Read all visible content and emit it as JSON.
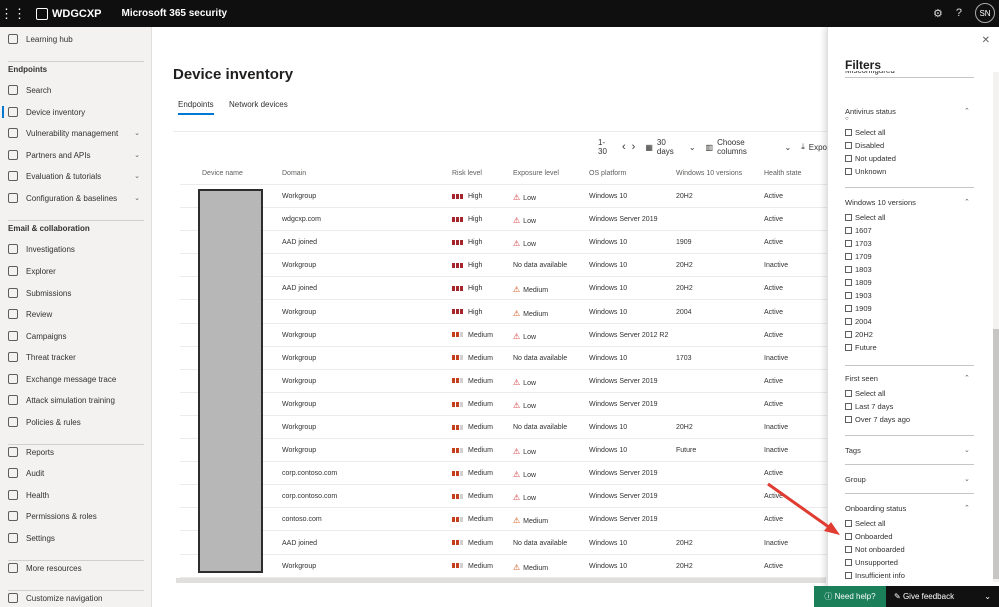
{
  "topbar": {
    "brand": "WDGCXP",
    "app": "Microsoft 365 security",
    "avatar": "SN",
    "icons": [
      "waffle-icon",
      "gear-icon",
      "help-icon"
    ]
  },
  "sidebar": {
    "items": [
      {
        "label": "Learning hub",
        "icon": "learning-hub-icon"
      },
      {
        "label": "Endpoints",
        "section": true
      },
      {
        "label": "Search",
        "icon": "search-icon"
      },
      {
        "label": "Device inventory",
        "icon": "device-inventory-icon",
        "active": true
      },
      {
        "label": "Vulnerability management",
        "icon": "vulnerability-icon",
        "chevron": true
      },
      {
        "label": "Partners and APIs",
        "icon": "partners-icon",
        "chevron": true
      },
      {
        "label": "Evaluation & tutorials",
        "icon": "evaluation-icon",
        "chevron": true
      },
      {
        "label": "Configuration & baselines",
        "icon": "configuration-icon",
        "chevron": true
      },
      {
        "label": "Email & collaboration",
        "section": true
      },
      {
        "label": "Investigations",
        "icon": "investigations-icon"
      },
      {
        "label": "Explorer",
        "icon": "explorer-icon"
      },
      {
        "label": "Submissions",
        "icon": "submissions-icon"
      },
      {
        "label": "Review",
        "icon": "review-icon"
      },
      {
        "label": "Campaigns",
        "icon": "campaigns-icon"
      },
      {
        "label": "Threat tracker",
        "icon": "threat-tracker-icon"
      },
      {
        "label": "Exchange message trace",
        "icon": "exchange-icon"
      },
      {
        "label": "Attack simulation training",
        "icon": "attack-sim-icon"
      },
      {
        "label": "Policies & rules",
        "icon": "policies-icon"
      },
      {
        "label": "Reports",
        "icon": "reports-icon"
      },
      {
        "label": "Audit",
        "icon": "audit-icon"
      },
      {
        "label": "Health",
        "icon": "health-icon"
      },
      {
        "label": "Permissions & roles",
        "icon": "permissions-icon"
      },
      {
        "label": "Settings",
        "icon": "settings-icon"
      },
      {
        "label": "More resources",
        "icon": "more-resources-icon"
      },
      {
        "label": "Customize navigation",
        "icon": "customize-icon"
      }
    ]
  },
  "main": {
    "title": "Device inventory",
    "tabs": [
      "Endpoints",
      "Network devices"
    ],
    "toolbar": {
      "range": "1-30",
      "days": "30 days",
      "choose_columns": "Choose columns",
      "export": "Expo"
    },
    "columns": [
      "Device name",
      "Domain",
      "Risk level",
      "Exposure level",
      "OS platform",
      "Windows 10 versions",
      "Health state"
    ],
    "rows": [
      {
        "domain": "Workgroup",
        "risk": "High",
        "exposure": "Low",
        "os": "Windows 10",
        "ver": "20H2",
        "health": "Active"
      },
      {
        "domain": "wdgcxp.com",
        "risk": "High",
        "exposure": "Low",
        "os": "Windows Server 2019",
        "ver": "",
        "health": "Active"
      },
      {
        "domain": "AAD joined",
        "risk": "High",
        "exposure": "Low",
        "os": "Windows 10",
        "ver": "1909",
        "health": "Active"
      },
      {
        "domain": "Workgroup",
        "risk": "High",
        "exposure": "No data available",
        "os": "Windows 10",
        "ver": "20H2",
        "health": "Inactive"
      },
      {
        "domain": "AAD joined",
        "risk": "High",
        "exposure": "Medium",
        "os": "Windows 10",
        "ver": "20H2",
        "health": "Active"
      },
      {
        "domain": "Workgroup",
        "risk": "High",
        "exposure": "Medium",
        "os": "Windows 10",
        "ver": "2004",
        "health": "Active"
      },
      {
        "domain": "Workgroup",
        "risk": "Medium",
        "exposure": "Low",
        "os": "Windows Server 2012 R2",
        "ver": "",
        "health": "Active"
      },
      {
        "domain": "Workgroup",
        "risk": "Medium",
        "exposure": "No data available",
        "os": "Windows 10",
        "ver": "1703",
        "health": "Inactive"
      },
      {
        "domain": "Workgroup",
        "risk": "Medium",
        "exposure": "Low",
        "os": "Windows Server 2019",
        "ver": "",
        "health": "Active"
      },
      {
        "domain": "Workgroup",
        "risk": "Medium",
        "exposure": "Low",
        "os": "Windows Server 2019",
        "ver": "",
        "health": "Active"
      },
      {
        "domain": "Workgroup",
        "risk": "Medium",
        "exposure": "No data available",
        "os": "Windows 10",
        "ver": "20H2",
        "health": "Inactive"
      },
      {
        "domain": "Workgroup",
        "risk": "Medium",
        "exposure": "Low",
        "os": "Windows 10",
        "ver": "Future",
        "health": "Inactive"
      },
      {
        "domain": "corp.contoso.com",
        "risk": "Medium",
        "exposure": "Low",
        "os": "Windows Server 2019",
        "ver": "",
        "health": "Active"
      },
      {
        "domain": "corp.contoso.com",
        "risk": "Medium",
        "exposure": "Low",
        "os": "Windows Server 2019",
        "ver": "",
        "health": "Active"
      },
      {
        "domain": "contoso.com",
        "risk": "Medium",
        "exposure": "Medium",
        "os": "Windows Server 2019",
        "ver": "",
        "health": "Active"
      },
      {
        "domain": "AAD joined",
        "risk": "Medium",
        "exposure": "No data available",
        "os": "Windows 10",
        "ver": "20H2",
        "health": "Inactive"
      },
      {
        "domain": "Workgroup",
        "risk": "Medium",
        "exposure": "Medium",
        "os": "Windows 10",
        "ver": "20H2",
        "health": "Active"
      }
    ]
  },
  "filters": {
    "title": "Filters",
    "partial_top": "Misconfigured",
    "groups": [
      {
        "name": "Antivirus status",
        "expanded": true,
        "options": [
          "Select all",
          "Disabled",
          "Not updated",
          "Unknown"
        ]
      },
      {
        "name": "Windows 10 versions",
        "expanded": true,
        "options": [
          "Select all",
          "1607",
          "1703",
          "1709",
          "1803",
          "1809",
          "1903",
          "1909",
          "2004",
          "20H2",
          "Future"
        ]
      },
      {
        "name": "First seen",
        "expanded": true,
        "options": [
          "Select all",
          "Last 7 days",
          "Over 7 days ago"
        ]
      },
      {
        "name": "Tags",
        "expanded": false,
        "options": []
      },
      {
        "name": "Group",
        "expanded": false,
        "options": []
      },
      {
        "name": "Onboarding status",
        "expanded": true,
        "options": [
          "Select all",
          "Onboarded",
          "Not onboarded",
          "Unsupported",
          "Insufficient info"
        ]
      }
    ]
  },
  "footer": {
    "help": "Need help?",
    "feedback": "Give feedback"
  },
  "colors": {
    "accent": "#0078d4",
    "risk_high": "#a4262c",
    "risk_medium": "#c43e1c",
    "arrow": "#e03c31",
    "help_bg": "#1b7f5a"
  }
}
